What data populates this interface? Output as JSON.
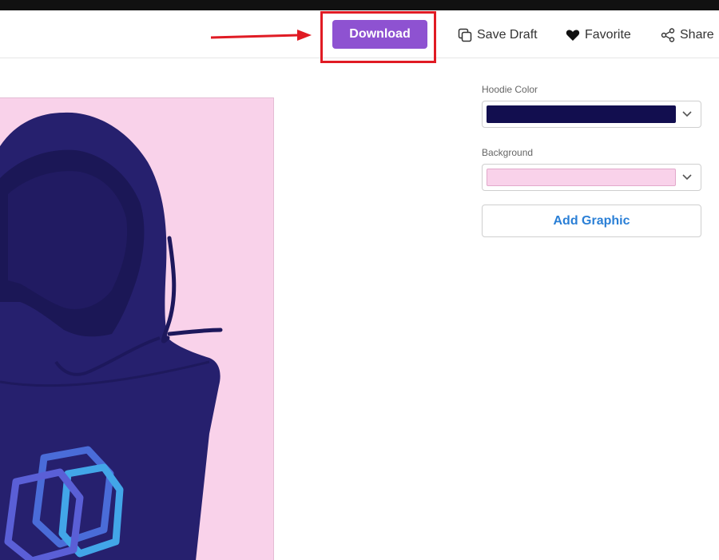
{
  "header": {
    "download_label": "Download",
    "save_draft_label": "Save Draft",
    "favorite_label": "Favorite",
    "share_label": "Share"
  },
  "panel": {
    "hoodie_color_label": "Hoodie Color",
    "hoodie_color_value": "#120e4f",
    "background_label": "Background",
    "background_value": "#f9d2ea",
    "add_graphic_label": "Add Graphic"
  },
  "colors": {
    "download_button": "#8e52d1",
    "annotation_red": "#e01b24",
    "hoodie": "#26206e",
    "link_blue": "#2a7fd6"
  },
  "icons": {
    "save_draft": "copy-icon",
    "favorite": "heart-icon",
    "share": "share-icon",
    "dropdown": "chevron-down-icon"
  }
}
